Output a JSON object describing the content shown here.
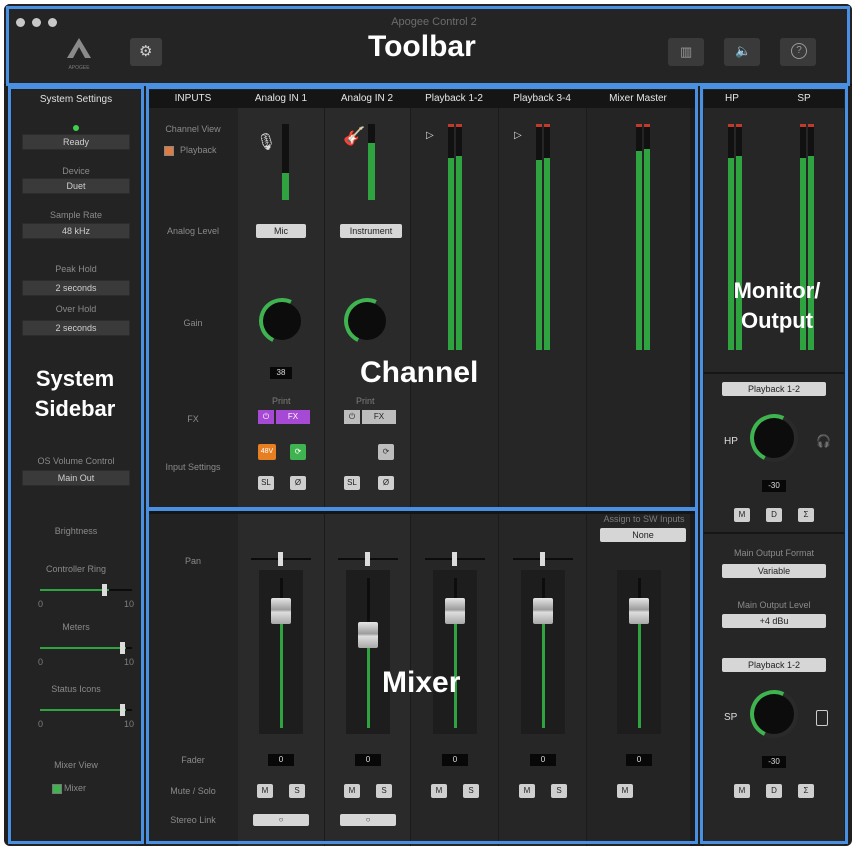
{
  "window": {
    "title": "Apogee Control 2",
    "logo_text": "APOGEE"
  },
  "toolbar": {
    "callout_label": "Toolbar",
    "gear_icon": "gear-icon",
    "right_icons": [
      "meters-icon",
      "speaker-icon",
      "help-icon"
    ]
  },
  "sidebar": {
    "callout_label": "System\nSidebar",
    "title": "System Settings",
    "status": "Ready",
    "device_label": "Device",
    "device_value": "Duet",
    "sample_rate_label": "Sample Rate",
    "sample_rate_value": "48 kHz",
    "peak_hold_label": "Peak Hold",
    "peak_hold_value": "2 seconds",
    "over_hold_label": "Over Hold",
    "over_hold_value": "2 seconds",
    "os_volume_label": "OS Volume Control",
    "os_volume_value": "Main Out",
    "brightness_label": "Brightness",
    "controller_ring_label": "Controller Ring",
    "meters_label": "Meters",
    "status_icons_label": "Status Icons",
    "slider_min": "0",
    "slider_max": "10",
    "controller_ring_level": 0.75,
    "meters_level": 0.95,
    "status_icons_level": 0.95,
    "mixer_view_label": "Mixer View",
    "mixer_view_value": "Mixer"
  },
  "channel": {
    "callout_label": "Channel",
    "headers": [
      "INPUTS",
      "Analog IN 1",
      "Analog IN 2",
      "Playback 1-2",
      "Playback 3-4",
      "Mixer Master"
    ],
    "row_labels": {
      "channel_view": "Channel View",
      "playback": "Playback",
      "analog_level": "Analog Level",
      "gain": "Gain",
      "fx": "FX",
      "input_settings": "Input Settings"
    },
    "in1": {
      "level": "Mic",
      "gain": "38",
      "print": "Print",
      "fx": "FX",
      "phantom": "48V",
      "sl": "SL",
      "phase": "Ø"
    },
    "in2": {
      "level": "Instrument",
      "print": "Print",
      "fx": "FX",
      "sl": "SL",
      "phase": "Ø"
    },
    "meter_scale": [
      "0",
      "3",
      "6",
      "12",
      "20",
      "30",
      "40",
      "50",
      "60"
    ],
    "meter_levels": [
      0.35,
      0.4,
      0.85,
      0.85,
      0.9
    ]
  },
  "mixer": {
    "callout_label": "Mixer",
    "row_labels": {
      "pan": "Pan",
      "fader": "Fader",
      "mute_solo": "Mute / Solo",
      "stereo_link": "Stereo Link"
    },
    "assign_label": "Assign to SW Inputs",
    "assign_value": "None",
    "fader_values": [
      "0",
      "0",
      "0",
      "0",
      "0"
    ],
    "mute": "M",
    "solo": "S",
    "fader_levels": [
      0.78,
      0.62,
      0.78,
      0.78,
      0.78
    ],
    "fader_scale": [
      "0",
      "-5",
      "-10",
      "-15",
      "-20",
      "-30",
      "-40",
      "-50",
      "-60"
    ]
  },
  "monitor": {
    "callout_label": "Monitor/\nOutput",
    "headers": [
      "HP",
      "SP"
    ],
    "hp_source": "Playback 1-2",
    "hp_label": "HP",
    "hp_value": "-30",
    "main_output_format_label": "Main Output Format",
    "main_output_format_value": "Variable",
    "main_output_level_label": "Main Output Level",
    "main_output_level_value": "+4 dBu",
    "sp_source": "Playback 1-2",
    "sp_label": "SP",
    "sp_value": "-30",
    "buttons": [
      "M",
      "D",
      "Σ"
    ]
  },
  "colors": {
    "accent": "#4a90e2",
    "meter_green": "#2fa340",
    "fx_purple": "#a64ad6",
    "phantom_orange": "#e67e22"
  }
}
